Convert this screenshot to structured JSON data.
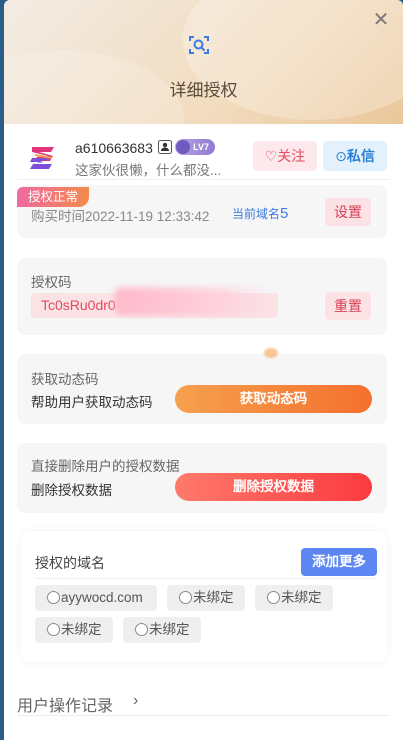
{
  "header": {
    "title": "详细授权",
    "close_icon": "close-icon",
    "scan_icon": "scan-search-icon"
  },
  "user": {
    "name": "a610663683",
    "level": "LV7",
    "bio": "这家伙很懒，什么都没...",
    "follow_label": "关注",
    "message_label": "私信"
  },
  "license": {
    "status": "授权正常",
    "purchase_time": "购买时间2022-11-19 12:33:42",
    "domain_prefix": "当前域名",
    "domain_count": "5",
    "settings_label": "设置"
  },
  "auth_code": {
    "label": "授权码",
    "value": "Tc0sRu0dr0",
    "reset_label": "重置"
  },
  "dynamic_code": {
    "title": "获取动态码",
    "desc": "帮助用户获取动态码",
    "button": "获取动态码"
  },
  "delete_data": {
    "title": "直接删除用户的授权数据",
    "desc": "删除授权数据",
    "button": "删除授权数据"
  },
  "domains": {
    "title": "授权的域名",
    "add_more": "添加更多",
    "items": [
      {
        "label": "ayywocd.com"
      },
      {
        "label": "未绑定"
      },
      {
        "label": "未绑定"
      },
      {
        "label": "未绑定"
      },
      {
        "label": "未绑定"
      }
    ]
  },
  "ops": {
    "label": "用户操作记录",
    "chevron": "›"
  },
  "colors": {
    "accent_blue": "#5c86f2",
    "accent_red": "#e3495f",
    "accent_orange": "#f5702d"
  }
}
